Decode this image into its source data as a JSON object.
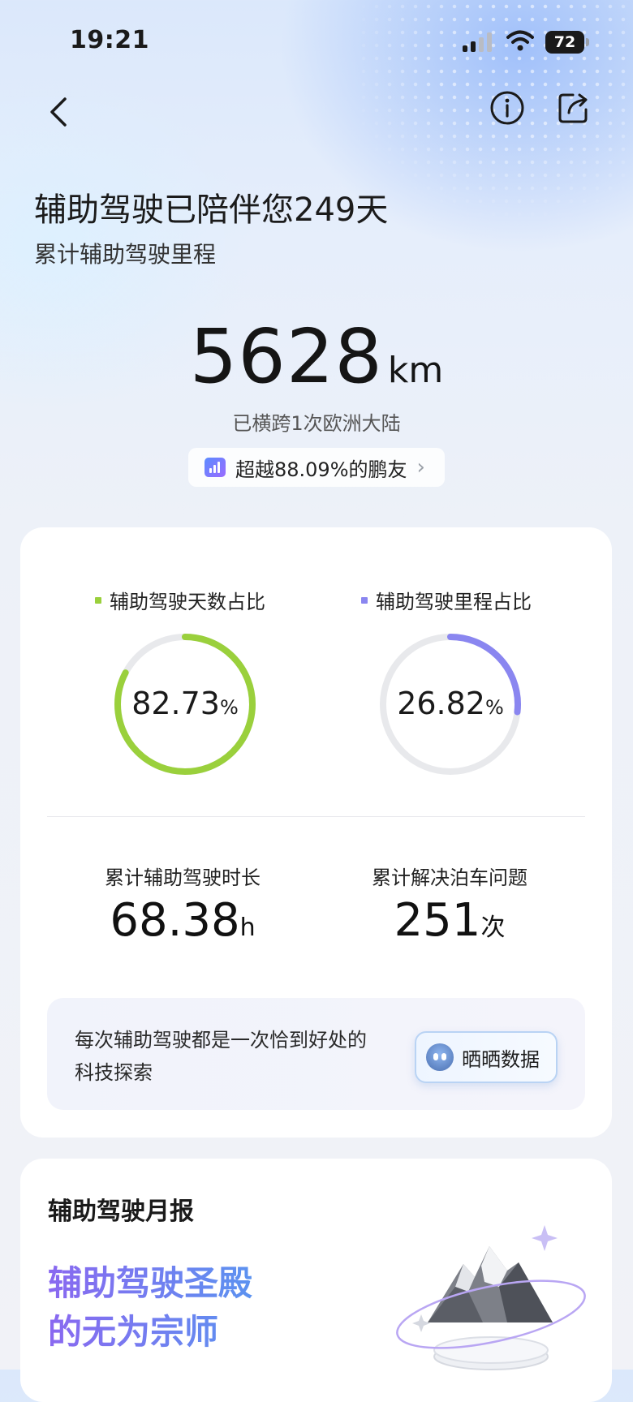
{
  "status_bar": {
    "time": "19:21",
    "battery": "72"
  },
  "header": {
    "headline": "辅助驾驶已陪伴您249天",
    "subline": "累计辅助驾驶里程",
    "distance_value": "5628",
    "distance_unit": "km",
    "distance_caption": "已横跨1次欧洲大陆",
    "rank_text": "超越88.09%的鹏友"
  },
  "ratios": [
    {
      "label": "辅助驾驶天数占比",
      "value": "82.73",
      "unit": "%",
      "fraction": 0.8273,
      "color": "#9ad03c"
    },
    {
      "label": "辅助驾驶里程占比",
      "value": "26.82",
      "unit": "%",
      "fraction": 0.2682,
      "color": "#8a86f0"
    }
  ],
  "metrics": [
    {
      "label": "累计辅助驾驶时长",
      "value": "68.38",
      "unit": "h"
    },
    {
      "label": "累计解决泊车问题",
      "value": "251",
      "unit": "次"
    }
  ],
  "promo": {
    "text": "每次辅助驾驶都是一次恰到好处的科技探索",
    "button_label": "晒晒数据"
  },
  "monthly": {
    "title": "辅助驾驶月报",
    "honor_line1": "辅助驾驶圣殿",
    "honor_line2": "的无为宗师"
  },
  "icons": [
    "back-icon",
    "info-icon",
    "share-icon",
    "chart-icon",
    "chevron-right-icon",
    "robot-icon",
    "mountain-icon"
  ]
}
